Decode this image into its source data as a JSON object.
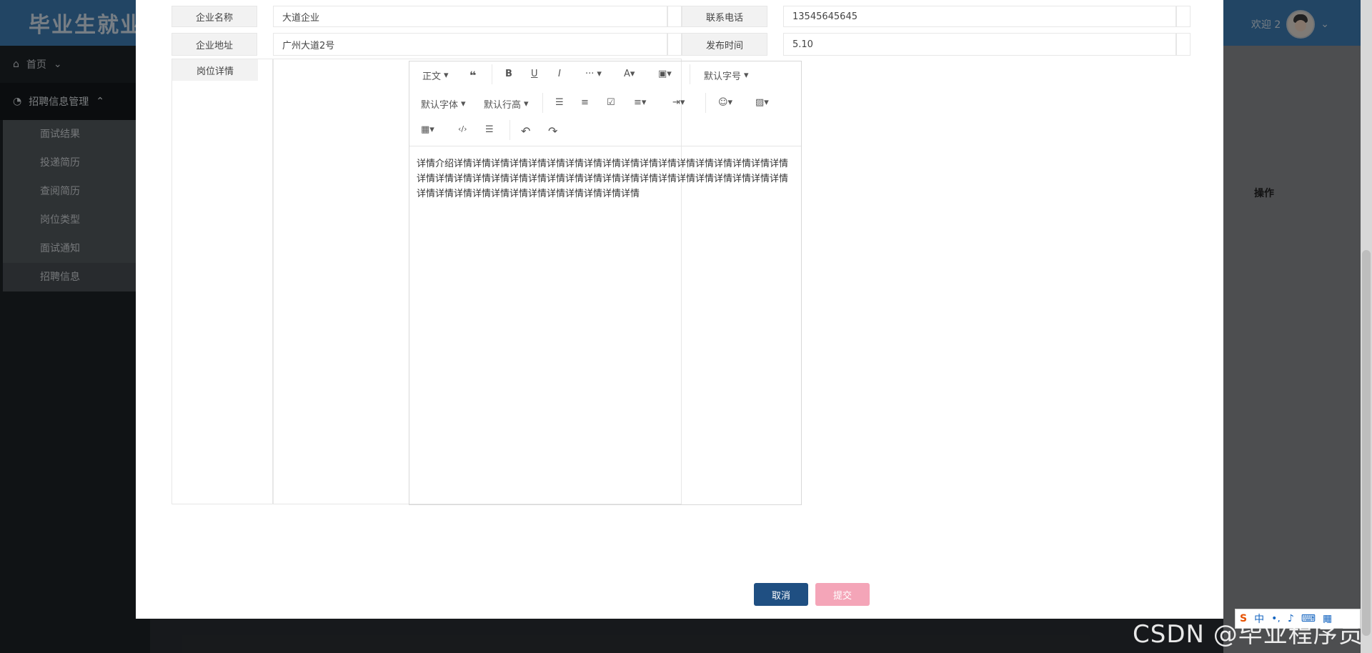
{
  "header": {
    "brand": "毕业生就业",
    "welcome": "欢迎 2"
  },
  "sidebar": {
    "home": "首页",
    "group": "招聘信息管理",
    "items": [
      "面试结果",
      "投递简历",
      "查阅简历",
      "岗位类型",
      "面试通知",
      "招聘信息"
    ]
  },
  "form": {
    "company_name_label": "企业名称",
    "company_name_value": "大道企业",
    "phone_label": "联系电话",
    "phone_value": "13545645645",
    "address_label": "企业地址",
    "address_value": "广州大道2号",
    "publish_label": "发布时间",
    "publish_value": "5.10",
    "detail_label": "岗位详情"
  },
  "editor": {
    "paragraph": "正文",
    "font_size": "默认字号",
    "font_family": "默认字体",
    "line_height": "默认行高",
    "bold": "B",
    "underline": "U",
    "italic": "I",
    "more": "···",
    "content": "详情介绍详情详情详情详情详情详情详情详情详情详情详情详情详情详情详情详情详情详情详情详情详情详情详情详情详情详情详情详情详情详情详情详情详情详情详情详情详情详情详情详情详情详情详情详情详情详情详情详情详情详情"
  },
  "buttons": {
    "cancel": "取消",
    "submit": "提交"
  },
  "table_header": {
    "ops": "操作"
  },
  "ime": {
    "lang": "中"
  },
  "watermark": "CSDN @毕业程序员",
  "colors": {
    "header_bg": "#3f7fb6",
    "primary": "#1f4f82",
    "submit": "#f4a5b8"
  }
}
